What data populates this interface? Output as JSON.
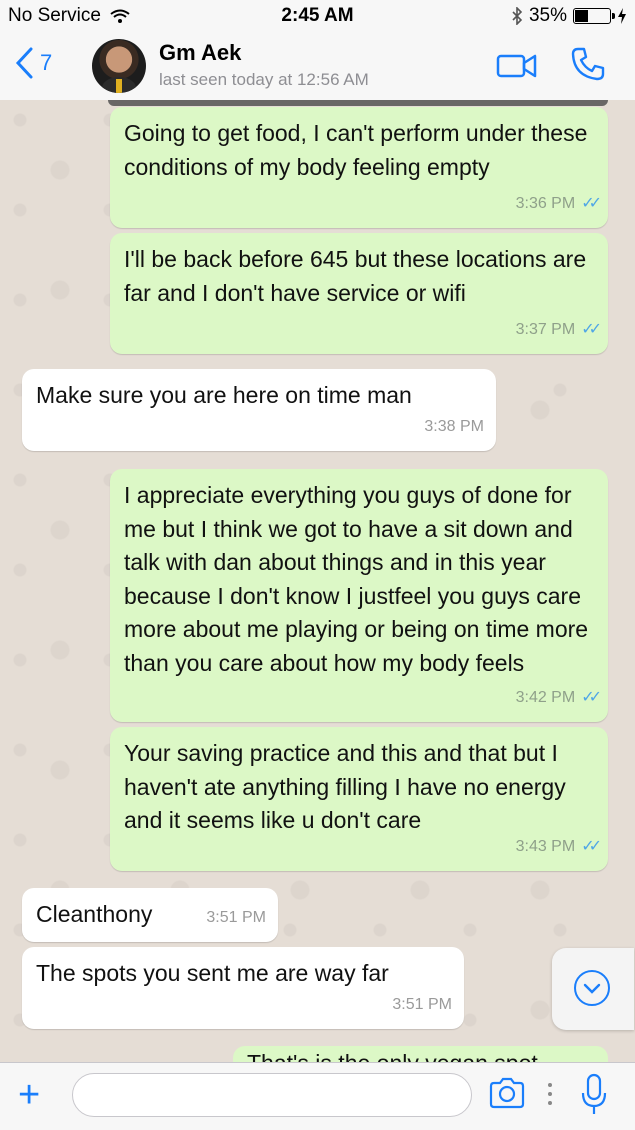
{
  "status_bar": {
    "carrier": "No Service",
    "time": "2:45 AM",
    "battery": "35%",
    "battery_level": 0.35
  },
  "header": {
    "back_count": "7",
    "name": "Gm Aek",
    "last_seen": "last seen today at 12:56 AM"
  },
  "messages": [
    {
      "dir": "out",
      "text": "Going to get food, I can't perform under these conditions of my body feeling empty",
      "time": "3:36 PM",
      "read": true
    },
    {
      "dir": "out",
      "text": "I'll be back before 645 but these locations are far and I don't have service or wifi",
      "time": "3:37 PM",
      "read": true
    },
    {
      "dir": "in",
      "text": "Make sure you are here on time man",
      "time": "3:38 PM"
    },
    {
      "dir": "out",
      "text": "I appreciate everything you guys of done for me but I think we got to have a sit down and talk with dan about things and in this year because I don't know I justfeel you guys care more about me playing or being on time more than you care about how my body feels",
      "time": "3:42 PM",
      "read": true
    },
    {
      "dir": "out",
      "text": "Your saving practice and this and that but I haven't ate anything filling I have no energy and it seems like u don't care",
      "time": "3:43 PM",
      "read": true
    },
    {
      "dir": "in",
      "text": "Cleanthony",
      "time": "3:51 PM"
    },
    {
      "dir": "in",
      "text": "The spots you sent me are way far",
      "time": "3:51 PM"
    }
  ],
  "partial_message": "That's is the only vegan spot",
  "input": {
    "placeholder": ""
  },
  "icons": {
    "back": "chevron-left-icon",
    "video": "video-camera-icon",
    "phone": "phone-icon",
    "attach": "plus-icon",
    "camera": "camera-icon",
    "mic": "microphone-icon",
    "scroll": "chevron-down-icon"
  },
  "colors": {
    "accent": "#1a7efb",
    "outgoing_bubble": "#dcf8c6",
    "incoming_bubble": "#ffffff",
    "read_ticks": "#4fa6e6"
  }
}
